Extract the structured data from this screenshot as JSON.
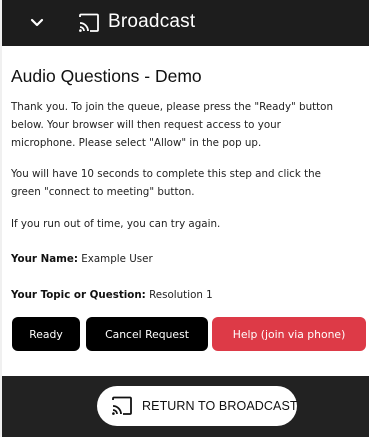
{
  "header": {
    "title": "Broadcast",
    "collapse_icon": "chevron-down-icon",
    "cast_icon": "cast-icon"
  },
  "main": {
    "title": "Audio Questions - Demo",
    "paragraphs": [
      "Thank you. To join the queue, please press the \"Ready\" button",
      "below. Your browser will then request access to your",
      "microphone. Please select \"Allow\" in the pop up.",
      "You will have 10 seconds to complete this step and click the",
      "green \"connect to meeting\" button.",
      "If you run out of time, you can try again."
    ],
    "name_label": "Your Name:",
    "name_value": "Example User",
    "topic_label": "Your Topic or Question:",
    "topic_value": "Resolution 1"
  },
  "buttons": {
    "ready": "Ready",
    "cancel": "Cancel Request",
    "help": "Help (join via phone)"
  },
  "footer": {
    "return_label": "RETURN TO BROADCAST",
    "return_icon": "cast-icon"
  },
  "colors": {
    "header_bg": "#1d1d1d",
    "footer_bg": "#222222",
    "help_button": "#dd3a47",
    "primary_button": "#000000"
  }
}
